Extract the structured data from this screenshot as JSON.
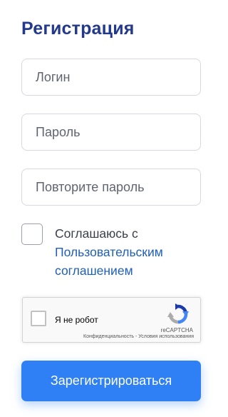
{
  "form": {
    "title": "Регистрация",
    "login": {
      "placeholder": "Логин",
      "value": ""
    },
    "password": {
      "placeholder": "Пароль",
      "value": ""
    },
    "password_repeat": {
      "placeholder": "Повторите пароль",
      "value": ""
    },
    "agree": {
      "checked": false,
      "text": "Соглашаюсь с",
      "link_text": "Пользовательским соглашением"
    },
    "submit_label": "Зарегистрироваться"
  },
  "recaptcha": {
    "label": "Я не робот",
    "brand": "reCAPTCHA",
    "privacy": "Конфиденциальность",
    "separator": " - ",
    "terms": "Условия использования"
  },
  "colors": {
    "title": "#233a8c",
    "link": "#1f5fb8",
    "button": "#2f80f5"
  }
}
